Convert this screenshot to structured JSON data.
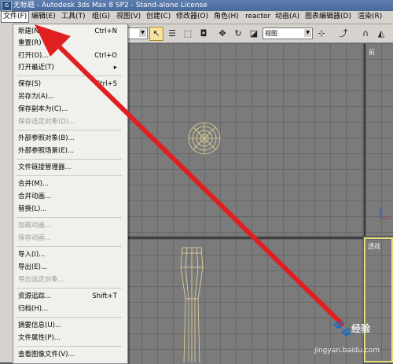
{
  "window": {
    "title": "无标题 - Autodesk 3ds Max 8 SP2 - Stand-alone License",
    "icon_text": "G"
  },
  "menubar": [
    {
      "label": "文件(F)"
    },
    {
      "label": "编辑(E)"
    },
    {
      "label": "工具(T)"
    },
    {
      "label": "组(G)"
    },
    {
      "label": "视图(V)"
    },
    {
      "label": "创建(C)"
    },
    {
      "label": "修改器(O)"
    },
    {
      "label": "角色(H)"
    },
    {
      "label": "reactor"
    },
    {
      "label": "动画(A)"
    },
    {
      "label": "图表编辑器(D)"
    },
    {
      "label": "渲染(R)"
    }
  ],
  "toolbar": {
    "view_combo": "视图"
  },
  "file_menu": [
    {
      "label": "新建(N)...",
      "shortcut": "Ctrl+N",
      "enabled": true
    },
    {
      "label": "重置(R)",
      "shortcut": "",
      "enabled": true
    },
    {
      "label": "打开(O)...",
      "shortcut": "Ctrl+O",
      "enabled": true
    },
    {
      "label": "打开最近(T)",
      "shortcut": "▸",
      "enabled": true
    },
    {
      "label": "保存(S)",
      "shortcut": "Ctrl+S",
      "enabled": true
    },
    {
      "label": "另存为(A)...",
      "shortcut": "",
      "enabled": true
    },
    {
      "label": "保存副本为(C)...",
      "shortcut": "",
      "enabled": true
    },
    {
      "label": "保存选定对象(D)...",
      "shortcut": "",
      "enabled": false
    },
    {
      "label": "外部参照对象(B)...",
      "shortcut": "",
      "enabled": true
    },
    {
      "label": "外部参照场景(E)...",
      "shortcut": "",
      "enabled": true
    },
    {
      "label": "文件链接管理器...",
      "shortcut": "",
      "enabled": true
    },
    {
      "label": "合并(M)...",
      "shortcut": "",
      "enabled": true
    },
    {
      "label": "合并动画...",
      "shortcut": "",
      "enabled": true
    },
    {
      "label": "替换(L)...",
      "shortcut": "",
      "enabled": true
    },
    {
      "label": "加载动画...",
      "shortcut": "",
      "enabled": false
    },
    {
      "label": "保存动画...",
      "shortcut": "",
      "enabled": false
    },
    {
      "label": "导入(I)...",
      "shortcut": "",
      "enabled": true
    },
    {
      "label": "导出(E)...",
      "shortcut": "",
      "enabled": true
    },
    {
      "label": "导出选定对象...",
      "shortcut": "",
      "enabled": false
    },
    {
      "label": "资源追踪...",
      "shortcut": "Shift+T",
      "enabled": true
    },
    {
      "label": "归档(H)...",
      "shortcut": "",
      "enabled": true
    },
    {
      "label": "摘要信息(U)...",
      "shortcut": "",
      "enabled": true
    },
    {
      "label": "文件属性(P)...",
      "shortcut": "",
      "enabled": true
    },
    {
      "label": "查看图像文件(V)...",
      "shortcut": "",
      "enabled": true
    }
  ],
  "viewports": {
    "front_label": "前",
    "perspective_label": "透视"
  },
  "watermark": {
    "brand": "经验",
    "url": "jingyan.baidu.com"
  },
  "colors": {
    "arrow": "#e02020",
    "wireframe": "#e8d89a",
    "viewport_bg": "#7b7b7b",
    "active_border": "#e8e080"
  }
}
